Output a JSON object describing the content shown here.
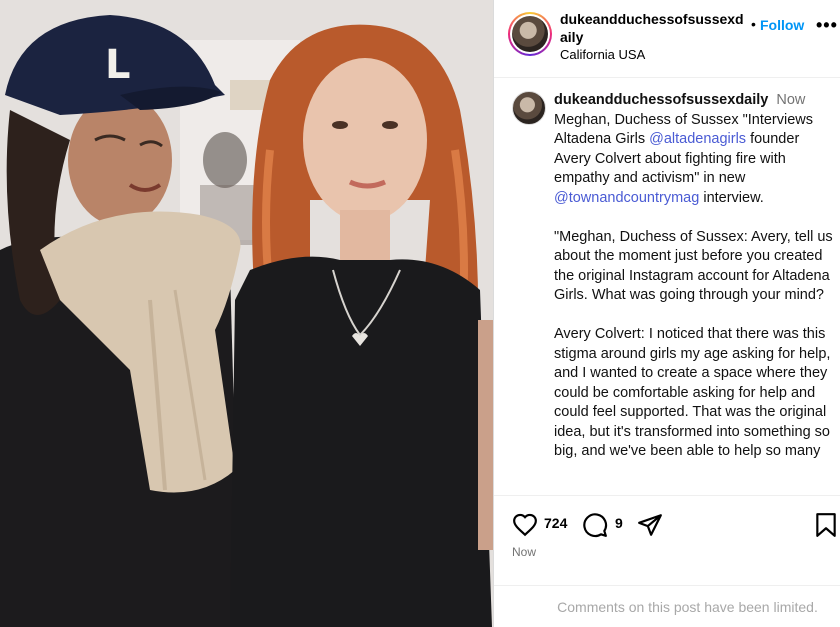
{
  "header": {
    "username": "dukeandduchessofsussexdaily",
    "location": "California USA",
    "dot": "•",
    "follow_label": "Follow",
    "more_label": "•••"
  },
  "caption": {
    "username": "dukeandduchessofsussexdaily",
    "time": "Now",
    "intro_before_mention1": "Meghan, Duchess of Sussex \"Interviews Altadena Girls ",
    "mention1": "@altadenagirls",
    "intro_between": " founder Avery Colvert about fighting fire with empathy and activism\" in new ",
    "mention2": "@townandcountrymag",
    "intro_after": " interview.",
    "paragraph2": "\"Meghan, Duchess of Sussex: Avery, tell us about the moment just before you created the original Instagram account for Altadena Girls. What was going through your mind?",
    "paragraph3": "Avery Colvert: I noticed that there was this stigma around girls my age asking for help, and I wanted to create a space where they could be comfortable asking for help and could feel supported. That was the original idea, but it's transformed into something so big, and we've been able to help so many"
  },
  "actions": {
    "like_count": "724",
    "comment_count": "9",
    "time": "Now",
    "icons": [
      "heart-icon",
      "comment-icon",
      "share-icon",
      "bookmark-icon"
    ]
  },
  "footer": {
    "limited_text": "Comments on this post have been limited."
  },
  "photo": {
    "cap_letter": "L"
  }
}
